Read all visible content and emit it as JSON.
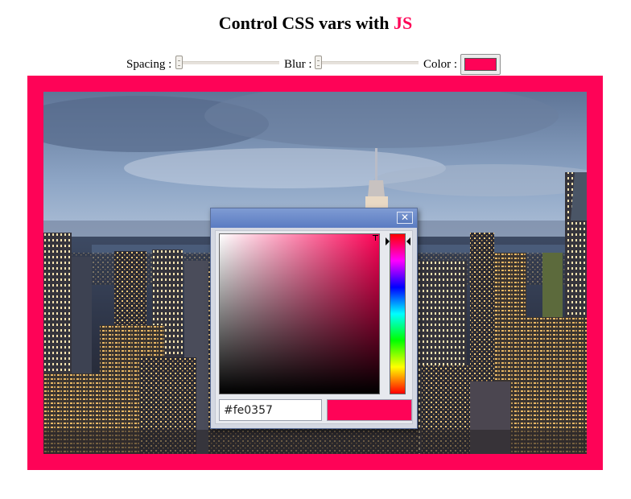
{
  "title": {
    "text": "Control CSS vars with ",
    "highlight": "JS"
  },
  "controls": {
    "spacing_label": "Spacing :",
    "spacing_value": 0,
    "blur_label": "Blur :",
    "blur_value": 0,
    "color_label": "Color :"
  },
  "accent_color": "#fe0357",
  "image": {
    "subject": "aerial city skyline at dusk"
  },
  "color_picker": {
    "close_icon": "close-icon",
    "hex_value": "#fe0357",
    "hue_marker": "hue-indicator-arrows",
    "preview_color": "#fe0357"
  }
}
